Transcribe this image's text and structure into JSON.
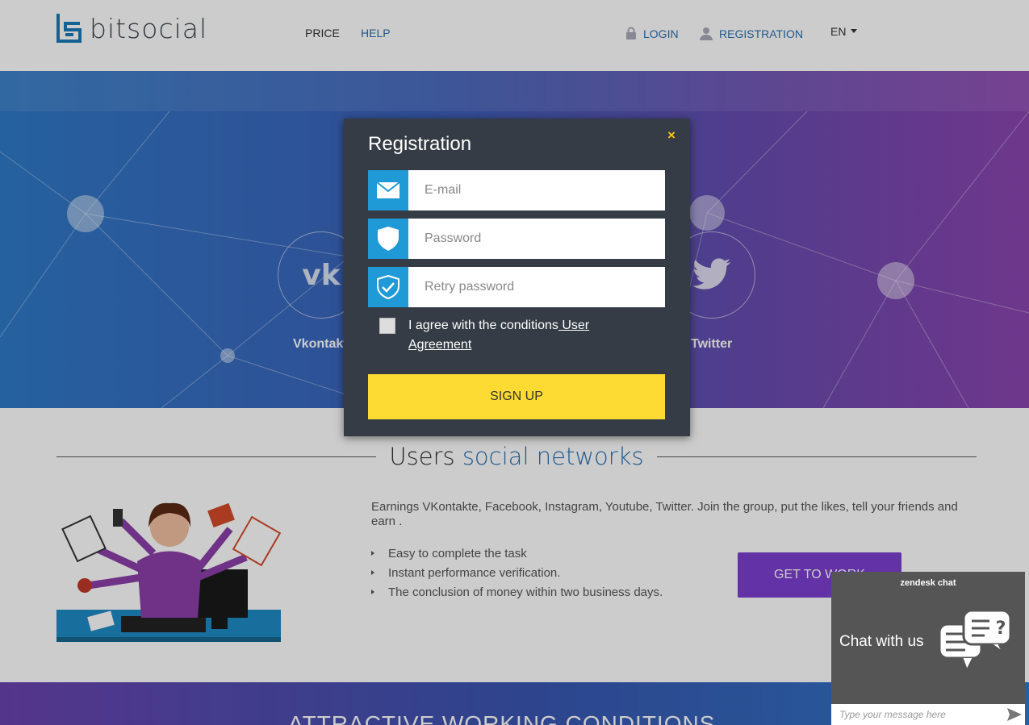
{
  "header": {
    "logo_text": "bitsocial",
    "nav": {
      "price": "PRICE",
      "help": "HELP"
    },
    "login": "LOGIN",
    "registration": "REGISTRATION",
    "language": "EN"
  },
  "hero": {
    "socials": [
      {
        "label": "Vkontakte",
        "icon": "vk-icon"
      },
      {
        "label": "Twitter",
        "icon": "twitter-icon"
      }
    ]
  },
  "section": {
    "title_plain": "Users",
    "title_accent": "social networks",
    "description": "Earnings VKontakte, Facebook, Instagram, Youtube, Twitter. Join the group, put the likes, tell your friends and earn .",
    "features": [
      "Easy to complete the task",
      "Instant performance verification.",
      "The conclusion of money within two business days."
    ],
    "cta": "GET TO WORK"
  },
  "band": {
    "title": "ATTRACTIVE WORKING CONDITIONS"
  },
  "modal": {
    "title": "Registration",
    "close": "×",
    "email_placeholder": "E-mail",
    "password_placeholder": "Password",
    "retry_placeholder": "Retry password",
    "agree_text": "I agree with the conditions",
    "agree_link": " User Agreement",
    "signup": "SIGN UP"
  },
  "zendesk": {
    "brand": "zendesk chat",
    "cta": "Chat with us",
    "input_placeholder": "Type your message here"
  },
  "colors": {
    "accent_blue": "#2a6fb0",
    "icon_blue": "#1f9ad6",
    "signup_yellow": "#fddb32",
    "modal_bg": "#353c45",
    "purple_button": "#7b3fd0"
  }
}
